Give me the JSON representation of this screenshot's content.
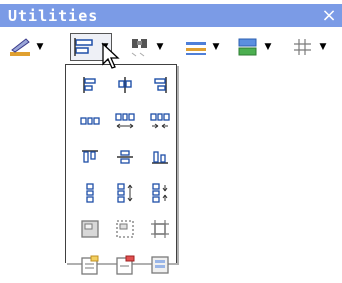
{
  "window": {
    "title": "Utilities",
    "close_glyph": "×"
  },
  "colors": {
    "titlebar": "#7b9be6",
    "icon_blue": "#1e4fa8",
    "icon_green": "#4caf50",
    "icon_orange": "#e0a030",
    "icon_gray": "#7a7a7a"
  },
  "toolbar": {
    "items": [
      {
        "icon": "line-style-icon",
        "arrow": "▼"
      },
      {
        "icon": "align-distribute-icon",
        "arrow": "▼"
      },
      {
        "icon": "binoculars-icon",
        "arrow": "▼"
      },
      {
        "icon": "line-weight-icon",
        "arrow": "▼"
      },
      {
        "icon": "fill-color-icon",
        "arrow": "▼"
      },
      {
        "icon": "grid-icon",
        "arrow": "▼"
      }
    ]
  },
  "dropdown": {
    "items": [
      "align-left-icon",
      "align-center-icon",
      "align-right-icon",
      "distribute-horizontal-icon",
      "expand-horizontal-icon",
      "shrink-horizontal-icon",
      "align-top-icon",
      "align-middle-icon",
      "align-bottom-icon",
      "distribute-vertical-icon",
      "expand-vertical-icon",
      "shrink-vertical-icon",
      "group-icon",
      "ungroup-icon",
      "make-same-size-icon",
      "bring-to-front-icon",
      "send-to-back-icon",
      "arrange-icon"
    ]
  }
}
